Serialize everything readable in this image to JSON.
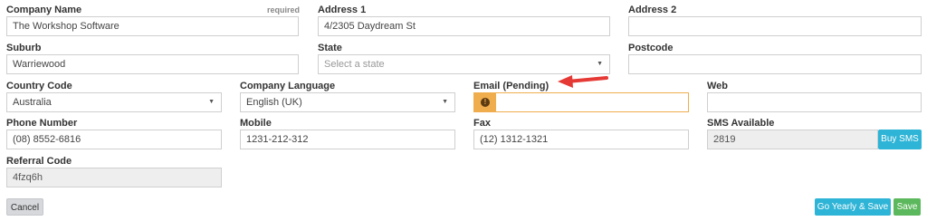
{
  "form": {
    "company_name": {
      "label": "Company Name",
      "required": "required",
      "value": "The Workshop Software"
    },
    "address1": {
      "label": "Address 1",
      "value": "4/2305 Daydream St"
    },
    "address2": {
      "label": "Address 2",
      "value": ""
    },
    "suburb": {
      "label": "Suburb",
      "value": "Warriewood"
    },
    "state": {
      "label": "State",
      "placeholder": "Select a state"
    },
    "postcode": {
      "label": "Postcode",
      "value": ""
    },
    "country_code": {
      "label": "Country Code",
      "value": "Australia"
    },
    "company_language": {
      "label": "Company Language",
      "value": "English (UK)"
    },
    "email": {
      "label": "Email (Pending)",
      "value": ""
    },
    "web": {
      "label": "Web",
      "value": ""
    },
    "phone": {
      "label": "Phone Number",
      "value": "(08) 8552-6816"
    },
    "mobile": {
      "label": "Mobile",
      "value": "1231-212-312"
    },
    "fax": {
      "label": "Fax",
      "value": "(12) 1312-1321"
    },
    "sms": {
      "label": "SMS Available",
      "value": "2819",
      "button": "Buy SMS"
    },
    "referral": {
      "label": "Referral Code",
      "value": "4fzq6h"
    }
  },
  "buttons": {
    "cancel": "Cancel",
    "go_yearly": "Go Yearly & Save",
    "save": "Save"
  },
  "icons": {
    "warning": "exclamation-circle-icon",
    "caret": "caret-down-icon",
    "annotation": "red-arrow-icon"
  },
  "colors": {
    "warning": "#f0ad4e",
    "blue": "#2eb4d6",
    "green": "#5cb85c",
    "arrow": "#e53935"
  }
}
